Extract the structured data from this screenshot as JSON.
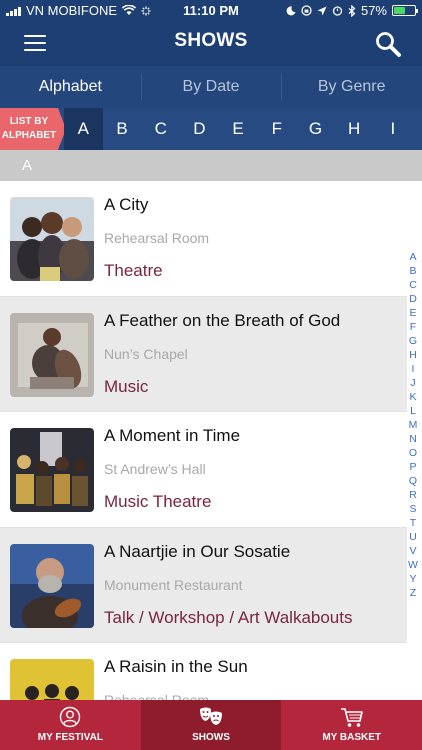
{
  "status": {
    "carrier": "VN MOBIFONE",
    "time": "11:10 PM",
    "battery": "57%",
    "battery_level": 0.57
  },
  "nav": {
    "title": "SHOWS",
    "menu_icon": "hamburger-menu-icon",
    "search_icon": "search-icon"
  },
  "tabs": [
    {
      "label": "Alphabet",
      "active": true
    },
    {
      "label": "By Date",
      "active": false
    },
    {
      "label": "By Genre",
      "active": false
    }
  ],
  "letter_strip": {
    "badge_line1": "LIST BY",
    "badge_line2": "ALPHABET",
    "letters": [
      "A",
      "B",
      "C",
      "D",
      "E",
      "F",
      "G",
      "H",
      "I"
    ],
    "active": "A"
  },
  "section": {
    "letter": "A"
  },
  "shows": [
    {
      "title": "A City",
      "venue": "Rehearsal Room",
      "genre": "Theatre"
    },
    {
      "title": "A Feather on the Breath of God",
      "venue": "Nun’s Chapel",
      "genre": "Music"
    },
    {
      "title": "A Moment in Time",
      "venue": "St Andrew’s Hall",
      "genre": "Music Theatre"
    },
    {
      "title": "A Naartjie in Our Sosatie",
      "venue": "Monument Restaurant",
      "genre": "Talk / Workshop / Art Walkabouts"
    },
    {
      "title": "A Raisin in the Sun",
      "venue": "Rehearsal Room",
      "genre": ""
    }
  ],
  "alpha_index": [
    "A",
    "B",
    "C",
    "D",
    "E",
    "F",
    "G",
    "H",
    "I",
    "J",
    "K",
    "L",
    "M",
    "N",
    "O",
    "P",
    "Q",
    "R",
    "S",
    "T",
    "U",
    "V",
    "W",
    "Y",
    "Z"
  ],
  "bottom_nav": [
    {
      "label": "MY FESTIVAL",
      "icon": "person-icon",
      "active": false
    },
    {
      "label": "SHOWS",
      "icon": "theatre-masks-icon",
      "active": true
    },
    {
      "label": "MY BASKET",
      "icon": "shopping-cart-icon",
      "active": false
    }
  ],
  "colors": {
    "header": "#1e3f73",
    "tabs": "#23467c",
    "strip": "#274a82",
    "badge": "#e9676a",
    "genre": "#7b2440",
    "bottom_nav": "#b3263b"
  }
}
